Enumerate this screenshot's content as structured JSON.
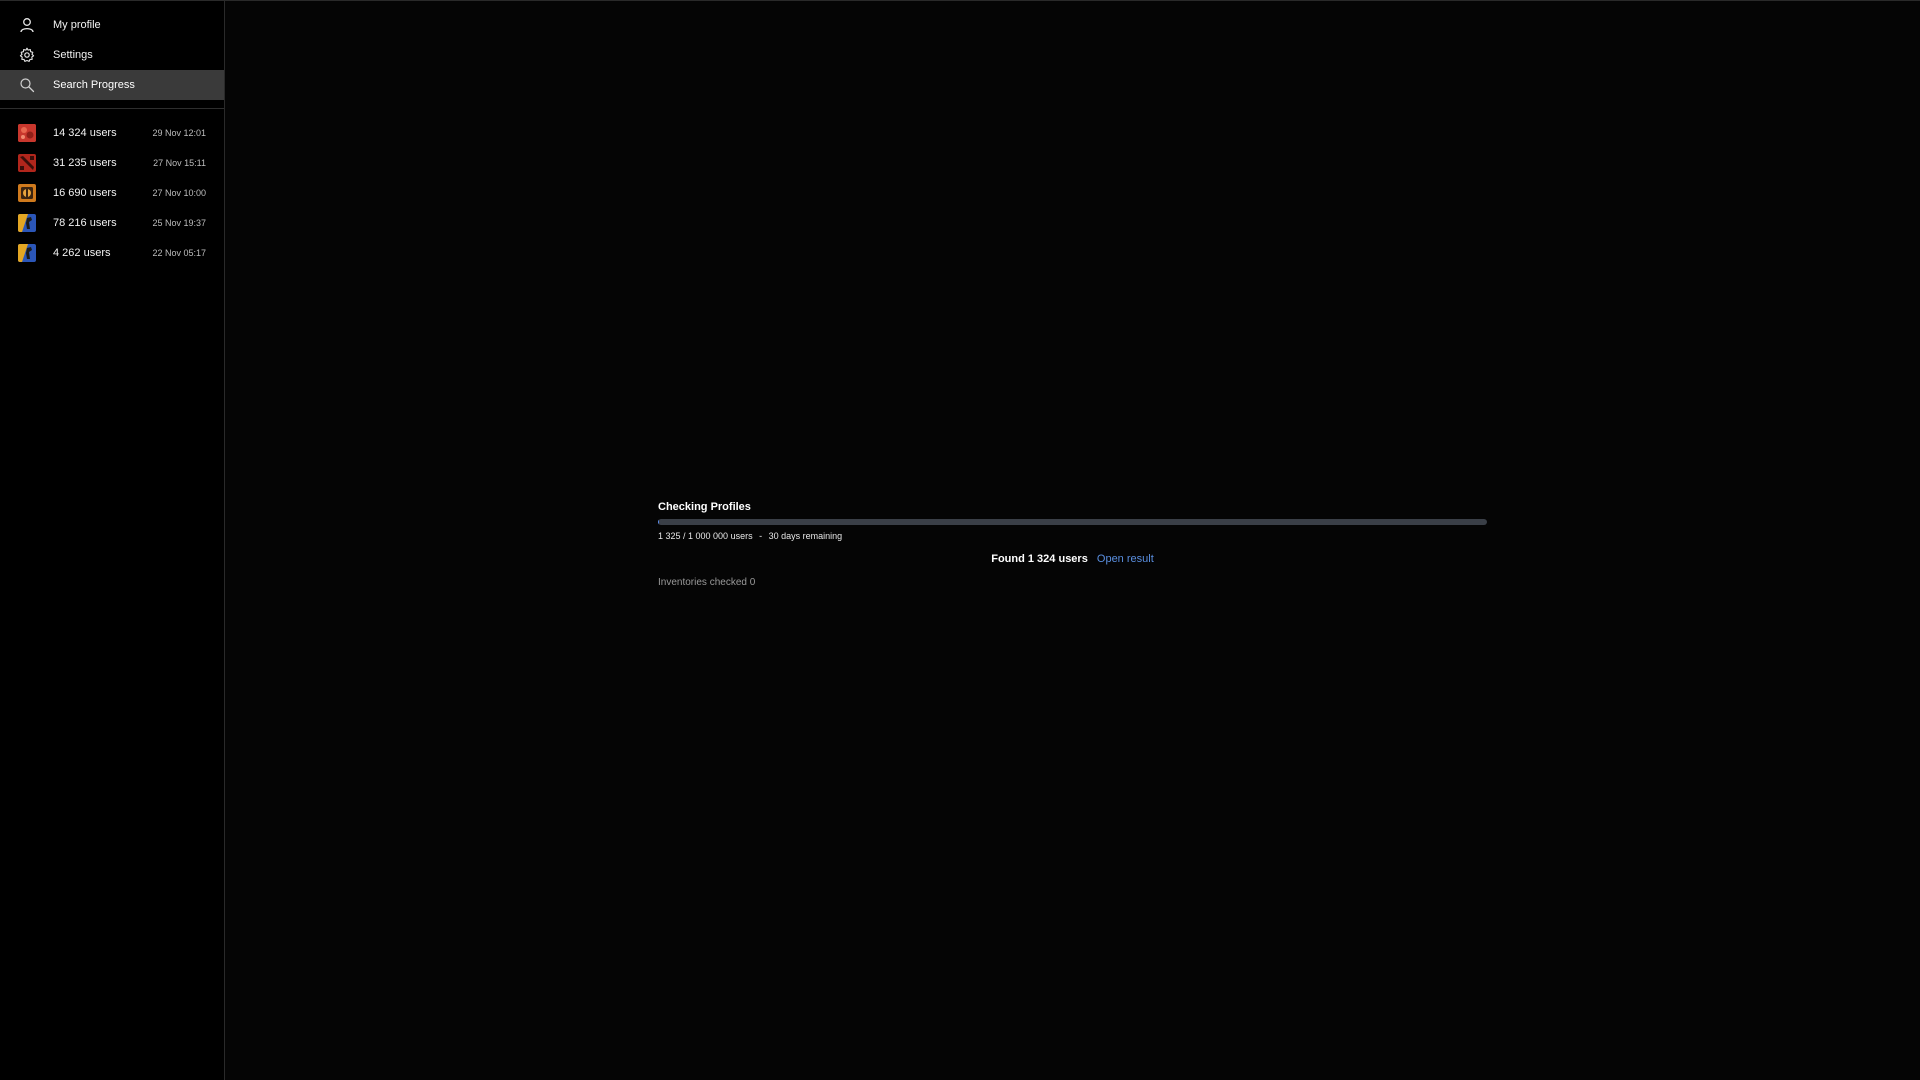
{
  "sidebar": {
    "nav": [
      {
        "label": "My profile",
        "icon": "user-icon"
      },
      {
        "label": "Settings",
        "icon": "gear-icon"
      },
      {
        "label": "Search Progress",
        "icon": "search-icon",
        "active": true
      }
    ],
    "searches": [
      {
        "count": "14 324 users",
        "date": "29 Nov 12:01",
        "icon": "rust-game-icon"
      },
      {
        "count": "31 235 users",
        "date": "27 Nov 15:11",
        "icon": "dota-game-icon"
      },
      {
        "count": "16 690 users",
        "date": "27 Nov 10:00",
        "icon": "tf2-game-icon"
      },
      {
        "count": "78 216 users",
        "date": "25 Nov 19:37",
        "icon": "csgo-game-icon"
      },
      {
        "count": "4 262 users",
        "date": "22 Nov 05:17",
        "icon": "csgo-game-icon"
      }
    ]
  },
  "progress": {
    "title": "Checking Profiles",
    "checked": "1 325 / 1 000 000 users",
    "separator": "-",
    "remaining": "30 days remaining",
    "fraction": 0.001325,
    "found": "Found 1 324 users",
    "open_result": "Open result",
    "inventories": "Inventories checked 0"
  },
  "colors": {
    "accent": "#5a8fe0",
    "track": "#3a3f47",
    "active_nav": "#3a3a3a"
  }
}
